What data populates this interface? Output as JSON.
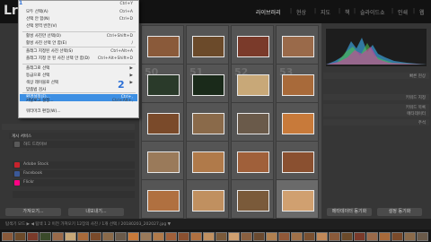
{
  "app": {
    "logo_text": "Lr"
  },
  "modules": [
    {
      "label": "라이브러리",
      "active": true
    },
    {
      "label": "현상",
      "active": false
    },
    {
      "label": "지도",
      "active": false
    },
    {
      "label": "책",
      "active": false
    },
    {
      "label": "슬라이드쇼",
      "active": false
    },
    {
      "label": "인쇄",
      "active": false
    },
    {
      "label": "웹",
      "active": false
    }
  ],
  "menu": {
    "items": [
      {
        "label": "",
        "shortcut": "Ctrl+Y"
      },
      {
        "label": "모두 선택(A)",
        "shortcut": "Ctrl+A"
      },
      {
        "label": "선택 안 함(N)",
        "shortcut": "Ctrl+D"
      },
      {
        "label": "선택 영역 반전(V)",
        "shortcut": ""
      },
      {
        "label": "활성 사진만 선택(O)",
        "shortcut": "Ctrl+Shift+D"
      },
      {
        "label": "활성 사진 선택 안 함(E)",
        "shortcut": "/"
      },
      {
        "label": "플래그 지정된 사진 선택(S)",
        "shortcut": "Ctrl+Alt+A"
      },
      {
        "label": "플래그 지정 안 된 사진 선택 안 함(D)",
        "shortcut": "Ctrl+Alt+Shift+D"
      },
      {
        "label": "플래그로 선택",
        "shortcut": "▶"
      },
      {
        "label": "등급으로 선택",
        "shortcut": "▶"
      },
      {
        "label": "색상 레이블로 선택",
        "shortcut": "▶"
      },
      {
        "label": "맞춤법 검사",
        "shortcut": ""
      },
      {
        "label": "환경설정(F)...",
        "shortcut": "Ctrl+,"
      },
      {
        "label": "카탈로그 설정...",
        "shortcut": "Ctrl+Alt+,"
      },
      {
        "label": "식별판 설정...",
        "shortcut": ""
      },
      {
        "label": "워터마크 편집(W)...",
        "shortcut": ""
      }
    ],
    "highlighted_index": 12
  },
  "steps": {
    "step1": "1",
    "step2": "2"
  },
  "publish": {
    "header": "게시 서비스",
    "rows": [
      {
        "label": "하드 드라이브",
        "color": "#5a5a5a"
      },
      {
        "label": "Adobe Stock",
        "color": "#c8232c"
      },
      {
        "label": "Facebook",
        "color": "#3b5998"
      },
      {
        "label": "Flickr",
        "color": "#ff0084"
      },
      {
        "label": "",
        "color": "#555555"
      }
    ]
  },
  "buttons": {
    "import": "가져오기...",
    "export": "내보내기...",
    "sync_metadata": "메타데이터 동기화",
    "sync_settings": "설정 동기화"
  },
  "right_panel": {
    "rows": [
      "빠른 현상",
      "키워드 지정",
      "키워드 목록",
      "메타데이터",
      "주석"
    ]
  },
  "grid": {
    "numbers": [
      "",
      "",
      "",
      "",
      "50",
      "51",
      "52",
      "53",
      "",
      "",
      "",
      "",
      "",
      "",
      "",
      "",
      "",
      "",
      "",
      ""
    ],
    "selected_index": 19,
    "thumb_colors": [
      "#8a5a3a",
      "#6b4a2a",
      "#7a3a2a",
      "#9a6a4a",
      "#2a3a2a",
      "#1a2a1a",
      "#c8a878",
      "#a86a3a",
      "#7a4a2a",
      "#8a6a4a",
      "#6a5a4a",
      "#c87a3a",
      "#9a7a5a",
      "#b07a4a",
      "#a0603a",
      "#8a5030",
      "#b07040",
      "#c09060",
      "#7a5a3a",
      "#d0a070"
    ]
  },
  "toolbar": {
    "text": "탐색기 모드 ▶ ◀  탐색   1 2   이전 가져오기   12장의 사진 / 1개 선택 / 20180203_202027.jpg ▼"
  },
  "film_colors": [
    "#8a5a3a",
    "#6b4a2a",
    "#7a3a2a",
    "#3a4a2a",
    "#9a6a4a",
    "#c8a878",
    "#a86a3a",
    "#7a4a2a",
    "#8a6a4a",
    "#6a5a4a",
    "#c87a3a",
    "#9a7a5a",
    "#b07a4a",
    "#a0603a",
    "#8a5030",
    "#b07040",
    "#c09060",
    "#7a5a3a",
    "#d0a070",
    "#8a6040",
    "#6a4a30",
    "#b08050",
    "#905838",
    "#a07048",
    "#7a5030",
    "#c08858",
    "#8a5a3a",
    "#6b4a2a",
    "#7a3a2a",
    "#9a6a4a",
    "#a86a3a",
    "#7a4a2a",
    "#8a6a4a",
    "#6a5a4a"
  ]
}
